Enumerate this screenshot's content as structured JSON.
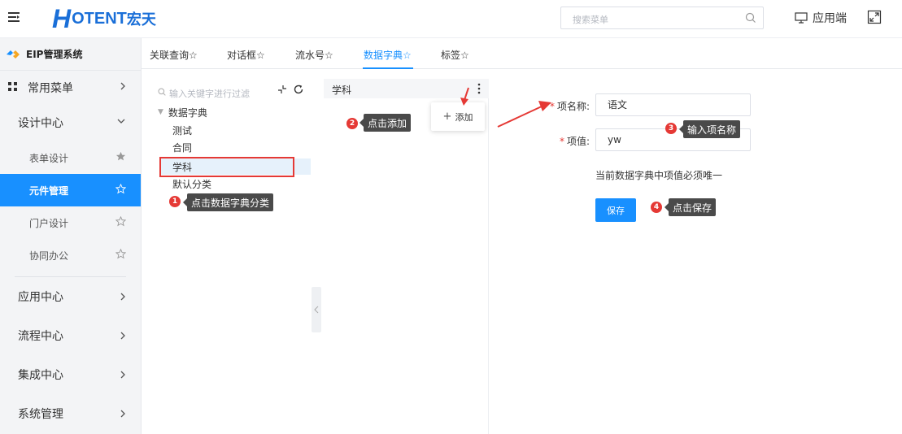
{
  "header": {
    "logo_h": "H",
    "logo_rest": "OTENT",
    "logo_cn": "宏天",
    "search_placeholder": "搜索菜单",
    "app_end_label": "应用端"
  },
  "sidebar": {
    "system_title": "EIP管理系统",
    "common_menu": "常用菜单",
    "design_center": "设计中心",
    "sub_items": [
      {
        "label": "表单设计"
      },
      {
        "label": "元件管理"
      },
      {
        "label": "门户设计"
      },
      {
        "label": "协同办公"
      }
    ],
    "items": [
      {
        "label": "应用中心"
      },
      {
        "label": "流程中心"
      },
      {
        "label": "集成中心"
      },
      {
        "label": "系统管理"
      }
    ]
  },
  "tabs": [
    {
      "label": "关联查询☆"
    },
    {
      "label": "对话框☆"
    },
    {
      "label": "流水号☆"
    },
    {
      "label": "数据字典☆"
    },
    {
      "label": "标签☆"
    }
  ],
  "tree": {
    "filter_placeholder": "输入关键字进行过滤",
    "root": "数据字典",
    "nodes": [
      "测试",
      "合同",
      "学科",
      "默认分类"
    ]
  },
  "middle": {
    "title": "学科",
    "add_label": "添加"
  },
  "form": {
    "name_label": "项名称:",
    "name_value": "语文",
    "value_label": "项值:",
    "value_value": "yw",
    "hint": "当前数据字典中项值必须唯一",
    "save_label": "保存"
  },
  "annotations": [
    {
      "num": "1",
      "text": "点击数据字典分类"
    },
    {
      "num": "2",
      "text": "点击添加"
    },
    {
      "num": "3",
      "text": "输入项名称"
    },
    {
      "num": "4",
      "text": "点击保存"
    }
  ],
  "colors": {
    "accent": "#1890ff",
    "annotation_red": "#e53935",
    "logo_blue": "#1a6fd8"
  }
}
